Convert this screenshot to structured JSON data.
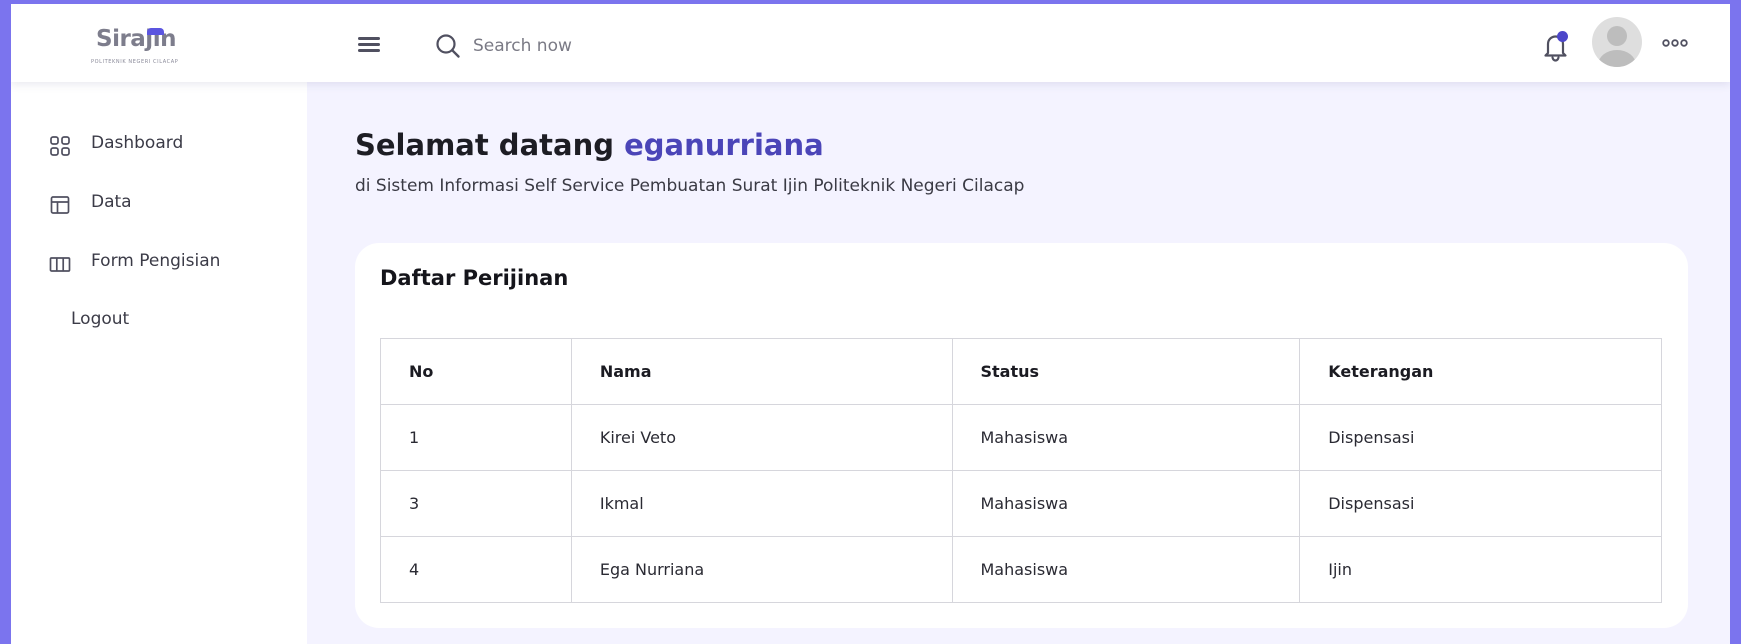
{
  "header": {
    "logo_text": "Sirajin",
    "logo_subtext": "POLITEKNIK NEGERI CILACAP",
    "search_placeholder": "Search now",
    "icons": {
      "menu": "hamburger-menu-icon",
      "search": "search-icon",
      "notification": "bell-icon",
      "avatar": "user-avatar",
      "more": "more-options-icon"
    }
  },
  "sidebar": {
    "items": [
      {
        "label": "Dashboard",
        "icon": "grid-icon"
      },
      {
        "label": "Data",
        "icon": "layout-icon"
      },
      {
        "label": "Form Pengisian",
        "icon": "columns-icon"
      },
      {
        "label": "Logout",
        "icon": ""
      }
    ]
  },
  "main": {
    "welcome_prefix": "Selamat datang",
    "username": "eganurriana",
    "subtitle": "di Sistem Informasi Self Service Pembuatan Surat Ijin Politeknik Negeri Cilacap",
    "card": {
      "title": "Daftar Perijinan",
      "columns": [
        "No",
        "Nama",
        "Status",
        "Keterangan"
      ],
      "rows": [
        [
          "1",
          "Kirei Veto",
          "Mahasiswa",
          "Dispensasi"
        ],
        [
          "3",
          "Ikmal",
          "Mahasiswa",
          "Dispensasi"
        ],
        [
          "4",
          "Ega Nurriana",
          "Mahasiswa",
          "Ijin"
        ]
      ]
    }
  },
  "colors": {
    "accent": "#4b45b8",
    "outer_background": "#7b74ee",
    "content_background": "#f4f3ff"
  }
}
